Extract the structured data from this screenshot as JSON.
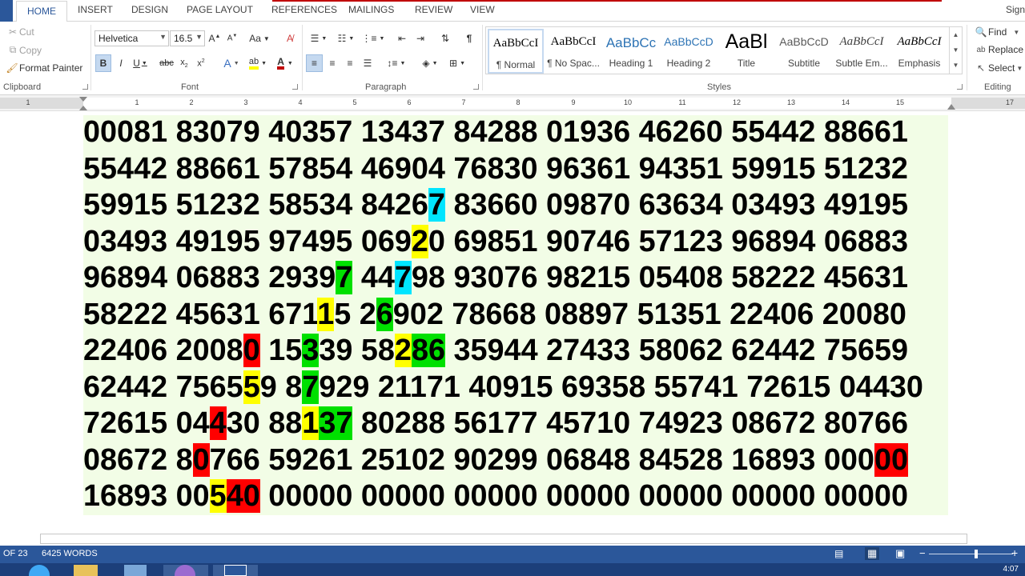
{
  "tabs": [
    "HOME",
    "INSERT",
    "DESIGN",
    "PAGE LAYOUT",
    "REFERENCES",
    "MAILINGS",
    "REVIEW",
    "VIEW"
  ],
  "active_tab": "HOME",
  "signin": "Sign",
  "clipboard": {
    "cut": "Cut",
    "copy": "Copy",
    "format_painter": "Format Painter",
    "label": "Clipboard"
  },
  "font": {
    "name": "Helvetica",
    "size": "16.5",
    "label": "Font",
    "case_btn": "Aa"
  },
  "paragraph": {
    "label": "Paragraph"
  },
  "styles": {
    "label": "Styles",
    "items": [
      {
        "preview": "AaBbCcI",
        "name": "¶ Normal"
      },
      {
        "preview": "AaBbCcI",
        "name": "¶ No Spac..."
      },
      {
        "preview": "AaBbCc",
        "name": "Heading 1"
      },
      {
        "preview": "AaBbCcD",
        "name": "Heading 2"
      },
      {
        "preview": "AaBl",
        "name": "Title"
      },
      {
        "preview": "AaBbCcD",
        "name": "Subtitle"
      },
      {
        "preview": "AaBbCcI",
        "name": "Subtle Em..."
      },
      {
        "preview": "AaBbCcI",
        "name": "Emphasis"
      }
    ]
  },
  "editing": {
    "find": "Find",
    "replace": "Replace",
    "select": "Select",
    "label": "Editing"
  },
  "ruler": {
    "numbers": [
      "1",
      "1",
      "2",
      "3",
      "4",
      "5",
      "6",
      "7",
      "8",
      "9",
      "10",
      "11",
      "12",
      "13",
      "14",
      "15",
      "17"
    ]
  },
  "document": {
    "lines": [
      [
        [
          "00081 83079 40357 13437 84288 01936 46260 55442 88661",
          ""
        ]
      ],
      [
        [
          "55442 88661 57854 46904 76830 96361 94351 59915 51232",
          ""
        ]
      ],
      [
        [
          "59915 51232 58534 8426",
          ""
        ],
        [
          "7",
          "cyan"
        ],
        [
          " 83660 09870 63634 03493 49195",
          ""
        ]
      ],
      [
        [
          "03493 49195 97495 069",
          ""
        ],
        [
          "2",
          "yellow"
        ],
        [
          "0 69851 90746 57123 96894 06883",
          ""
        ]
      ],
      [
        [
          "96894 06883 2939",
          ""
        ],
        [
          "7",
          "green"
        ],
        [
          " 44",
          ""
        ],
        [
          "7",
          "cyan"
        ],
        [
          "98 93076 98215 05408 58222 45631",
          ""
        ]
      ],
      [
        [
          "58222 45631 671",
          ""
        ],
        [
          "1",
          "yellow"
        ],
        [
          "5 2",
          ""
        ],
        [
          "6",
          "green"
        ],
        [
          "902 78668 08897 51351 22406 20080",
          ""
        ]
      ],
      [
        [
          "22406 2008",
          ""
        ],
        [
          "0",
          "red"
        ],
        [
          " 15",
          ""
        ],
        [
          "3",
          "green"
        ],
        [
          "39 58",
          ""
        ],
        [
          "2",
          "yellow"
        ],
        [
          "86",
          "green"
        ],
        [
          " 35944 27433 58062 62442 75659",
          ""
        ]
      ],
      [
        [
          "62442 7565",
          ""
        ],
        [
          "5",
          "yellow"
        ],
        [
          "9 8",
          ""
        ],
        [
          "7",
          "green"
        ],
        [
          "929 21171 40915 69358 55741 72615 04430",
          ""
        ]
      ],
      [
        [
          "72615 04",
          ""
        ],
        [
          "4",
          "red"
        ],
        [
          "30 88",
          ""
        ],
        [
          "1",
          "yellow"
        ],
        [
          "37",
          "green"
        ],
        [
          " 80288 56177 45710 74923 08672 80766",
          ""
        ]
      ],
      [
        [
          "08672 8",
          ""
        ],
        [
          "0",
          "red"
        ],
        [
          "766 59261 25102 90299 06848 84528 16893 000",
          ""
        ],
        [
          "00",
          "red"
        ]
      ],
      [
        [
          "16893 00",
          ""
        ],
        [
          "5",
          "yellow"
        ],
        [
          "40",
          "red"
        ],
        [
          " 00000 00000 00000 00000 00000 00000 00000",
          ""
        ]
      ]
    ]
  },
  "status": {
    "page": "OF 23",
    "words": "6425 WORDS"
  },
  "clock": "4:07",
  "colors": {
    "accent": "#2b579a",
    "doc_bg": "#f2fde6",
    "yellow": "#ffff00",
    "green": "#00e000",
    "cyan": "#00e5ff",
    "red": "#ff0000"
  }
}
